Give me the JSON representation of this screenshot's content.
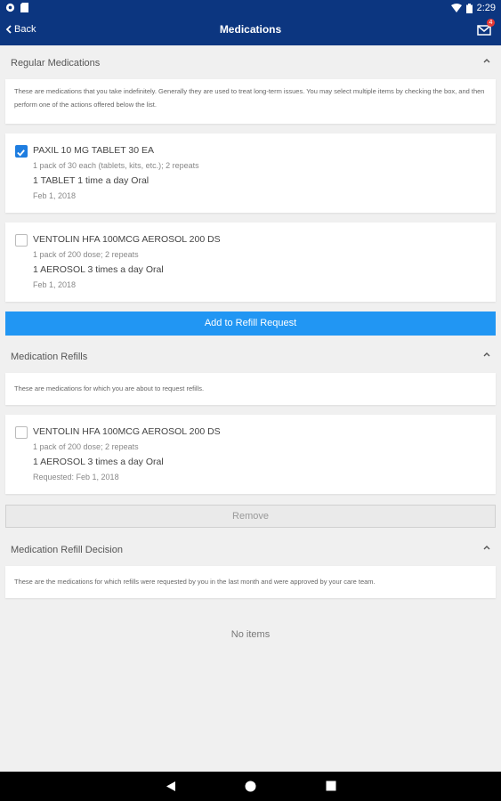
{
  "status_bar": {
    "time": "2:29",
    "left_icons": [
      "settings-gear-icon",
      "sd-card-icon"
    ],
    "right_icons": [
      "wifi-icon",
      "battery-icon"
    ]
  },
  "app_bar": {
    "back_label": "Back",
    "title": "Medications",
    "mail_badge": "4"
  },
  "sections": {
    "regular": {
      "title": "Regular Medications",
      "description": "These are medications that you take indefinitely. Generally they are used to treat long-term issues. You may select multiple items by checking the box, and then perform one of the actions offered below the list.",
      "items": [
        {
          "name": "PAXIL 10 MG TABLET 30 EA",
          "pack": "1 pack of 30 each (tablets, kits, etc.); 2 repeats",
          "dose": "1 TABLET 1 time a day Oral",
          "date": "Feb 1, 2018",
          "checked": true
        },
        {
          "name": "VENTOLIN HFA 100MCG AEROSOL 200 DS",
          "pack": "1 pack of 200 dose; 2 repeats",
          "dose": "1 AEROSOL 3 times a day Oral",
          "date": "Feb 1, 2018",
          "checked": false
        }
      ],
      "action_label": "Add to Refill Request"
    },
    "refills": {
      "title": "Medication Refills",
      "description": "These are medications for which you are about to request refills.",
      "items": [
        {
          "name": "VENTOLIN HFA 100MCG AEROSOL 200 DS",
          "pack": "1 pack of 200 dose; 2 repeats",
          "dose": "1 AEROSOL 3 times a day Oral",
          "date": "Requested: Feb 1, 2018",
          "checked": false
        }
      ],
      "action_label": "Remove"
    },
    "decision": {
      "title": "Medication Refill Decision",
      "description": "These are the medications for which refills were requested by you in the last month and were approved by your care team.",
      "empty_label": "No items"
    }
  },
  "colors": {
    "app_bar": "#0c3680",
    "primary_button": "#2196f3",
    "checkbox_checked": "#1e7de0",
    "badge": "#e53935"
  }
}
